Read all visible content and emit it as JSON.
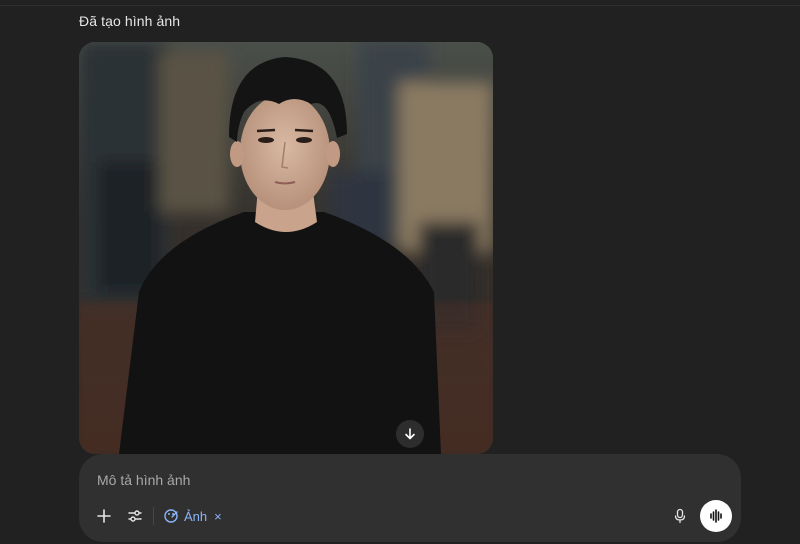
{
  "status": {
    "text": "Đã tạo hình ảnh"
  },
  "generated_image": {
    "subject": "portrait-of-young-man-in-black-sweater-crowd-background"
  },
  "composer": {
    "placeholder": "Mô tả hình ảnh",
    "value": "",
    "image_chip_label": "Ảnh",
    "image_chip_close": "×"
  },
  "icons": {
    "download": "arrow-down-icon",
    "plus": "plus-icon",
    "tools": "sliders-icon",
    "image_mode": "paint-palette-icon",
    "mic": "microphone-icon",
    "voice": "voice-waveform-icon"
  },
  "colors": {
    "background": "#212121",
    "composer": "#303030",
    "accent": "#8ab4f8",
    "text": "#ececec",
    "placeholder": "#a8a8a8"
  }
}
